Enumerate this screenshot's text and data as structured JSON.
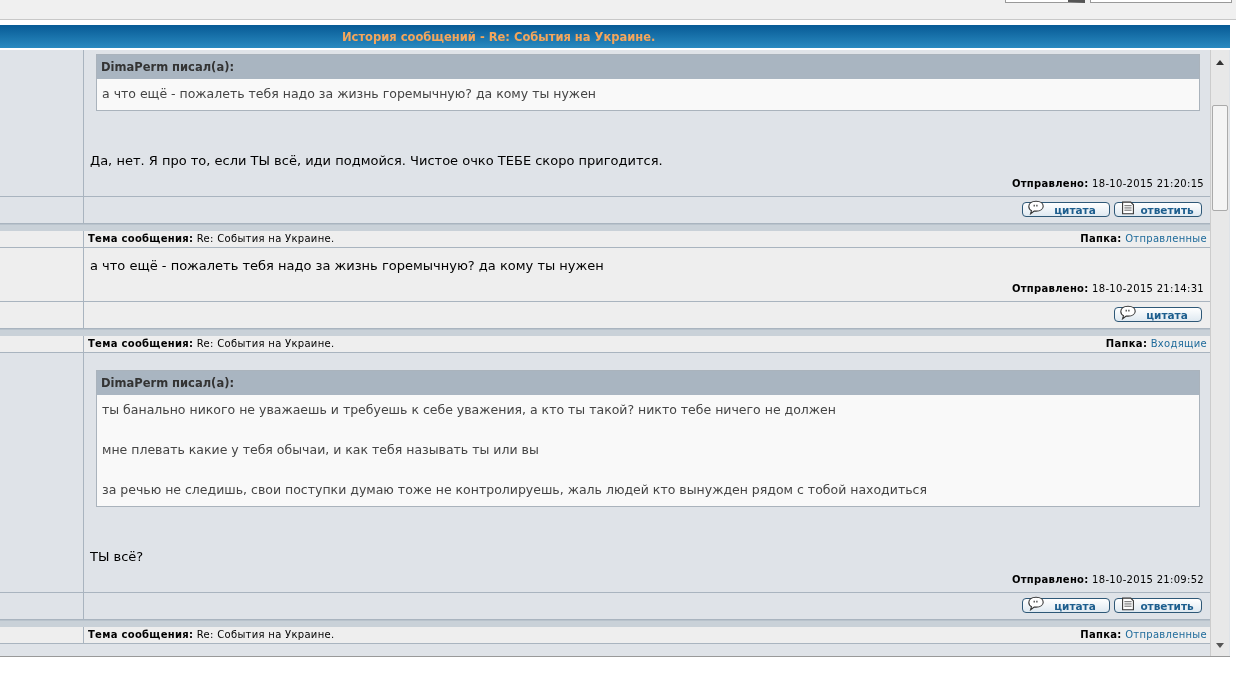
{
  "header": {
    "title": "История сообщений - Re: События на Украине."
  },
  "messages": [
    {
      "quote": {
        "author": "DimaPerm писал(а):",
        "paragraphs": [
          "а что ещё - пожалеть тебя надо за жизнь горемычную? да кому ты нужен"
        ]
      },
      "body": "Да, нет. Я про то, если ТЫ всё, иди подмойся. Чистое очко ТЕБЕ скоро пригодится.",
      "sent": {
        "label": "Отправлено:",
        "value": "18-10-2015 21:20:15"
      },
      "buttons": [
        {
          "kind": "quote",
          "label": "цитата"
        },
        {
          "kind": "reply",
          "label": "ответить"
        }
      ]
    },
    {
      "subject": {
        "label": "Тема сообщения:",
        "value": "Re: События на Украине."
      },
      "folder": {
        "label": "Папка:",
        "value": "Отправленные"
      },
      "body": "а что ещё - пожалеть тебя надо за жизнь горемычную? да кому ты нужен",
      "sent": {
        "label": "Отправлено:",
        "value": "18-10-2015 21:14:31"
      },
      "buttons": [
        {
          "kind": "quote",
          "label": "цитата"
        }
      ]
    },
    {
      "subject": {
        "label": "Тема сообщения:",
        "value": "Re: События на Украине."
      },
      "folder": {
        "label": "Папка:",
        "value": "Входящие"
      },
      "quote": {
        "author": "DimaPerm писал(а):",
        "paragraphs": [
          "ты банально никого не уважаешь и требуешь к себе уважения, а кто ты такой? никто тебе ничего не должен",
          "мне плевать какие у тебя обычаи, и как тебя называть ты или вы",
          "за речью не следишь, свои поступки думаю тоже не контролируешь, жаль людей кто вынужден рядом с тобой находиться"
        ]
      },
      "body": "ТЫ всё?",
      "sent": {
        "label": "Отправлено:",
        "value": "18-10-2015 21:09:52"
      },
      "buttons": [
        {
          "kind": "quote",
          "label": "цитата"
        },
        {
          "kind": "reply",
          "label": "ответить"
        }
      ]
    },
    {
      "subject": {
        "label": "Тема сообщения:",
        "value": "Re: События на Украине."
      },
      "folder": {
        "label": "Папка:",
        "value": "Отправленные"
      }
    }
  ]
}
